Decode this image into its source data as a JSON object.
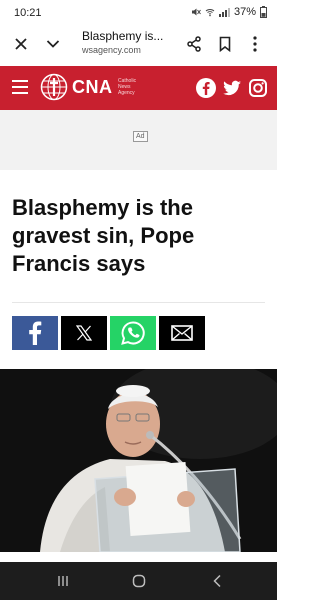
{
  "status_bar": {
    "time": "10:21",
    "battery": "37%"
  },
  "browser": {
    "page_title": "Blasphemy is...",
    "url": "wsagency.com"
  },
  "site_header": {
    "logo_text": "CNA",
    "logo_subtitle_1": "Catholic",
    "logo_subtitle_2": "News",
    "logo_subtitle_3": "Agency",
    "brand_color": "#c8202f"
  },
  "ad": {
    "label": "Ad"
  },
  "article": {
    "headline": "Blasphemy is the gravest sin, Pope Francis says"
  },
  "share_buttons": [
    {
      "name": "facebook",
      "label": "f",
      "color": "#3b5998"
    },
    {
      "name": "x",
      "label": "X",
      "color": "#000000"
    },
    {
      "name": "whatsapp",
      "label": "whatsapp",
      "color": "#25d366"
    },
    {
      "name": "email",
      "label": "email",
      "color": "#000000"
    }
  ]
}
